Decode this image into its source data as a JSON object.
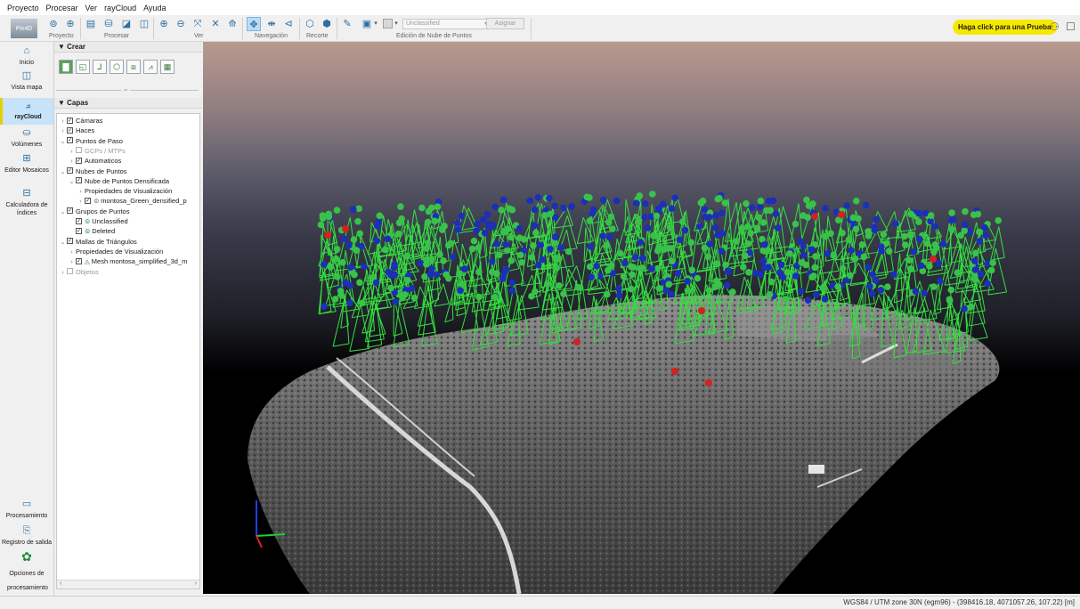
{
  "menu": [
    "Proyecto",
    "Procesar",
    "Ver",
    "rayCloud",
    "Ayuda"
  ],
  "toolbar": {
    "logo": "Pix4D",
    "groups": [
      "Proyecto",
      "Procesar",
      "Ver",
      "Navegación",
      "Recorte",
      "Edición de Nube de Puntos"
    ],
    "class_select": "Unclassified",
    "assign_label": "Asignar",
    "trial_label": "Haga click para una Prueba"
  },
  "rail": {
    "items": [
      "Inicio",
      "Vista mapa",
      "rayCloud",
      "Volúmenes",
      "Editor Mosaicos",
      "Calculadora de índices"
    ],
    "bottom": [
      "Procesamiento",
      "Registro de salida",
      "Opciones de procesamiento"
    ]
  },
  "panel": {
    "crear_title": "Crear",
    "capas_title": "Capas",
    "layers": [
      {
        "label": "Cámaras",
        "level": 0,
        "expander": "›",
        "check": true,
        "disabled": false
      },
      {
        "label": "Haces",
        "level": 0,
        "expander": "›",
        "check": true,
        "disabled": false
      },
      {
        "label": "Puntos de Paso",
        "level": 0,
        "expander": "⌄",
        "check": true,
        "disabled": false
      },
      {
        "label": "GCPs / MTPs",
        "level": 1,
        "expander": "›",
        "check": false,
        "disabled": true
      },
      {
        "label": "Automaticos",
        "level": 1,
        "expander": "›",
        "check": true,
        "disabled": false
      },
      {
        "label": "Nubes de Puntos",
        "level": 0,
        "expander": "⌄",
        "check": true,
        "disabled": false
      },
      {
        "label": "Nube de Puntos Densificada",
        "level": 1,
        "expander": "⌄",
        "check": true,
        "disabled": false
      },
      {
        "label": "Propiedades de Visualización",
        "level": 2,
        "expander": "›",
        "check": null,
        "disabled": false
      },
      {
        "label": "montosa_Green_densified_p",
        "level": 2,
        "expander": "›",
        "check": true,
        "disabled": false,
        "icon": "point-cloud-icon"
      },
      {
        "label": "Grupos de Puntos",
        "level": 0,
        "expander": "⌄",
        "check": true,
        "disabled": false
      },
      {
        "label": "Unclassified",
        "level": 1,
        "expander": "",
        "check": true,
        "disabled": false,
        "icon": "point-cloud-icon"
      },
      {
        "label": "Deleted",
        "level": 1,
        "expander": "",
        "check": true,
        "disabled": false,
        "icon": "point-cloud-icon"
      },
      {
        "label": "Mallas de Triángulos",
        "level": 0,
        "expander": "⌄",
        "check": true,
        "disabled": false
      },
      {
        "label": "Propiedades de Visualización",
        "level": 1,
        "expander": "›",
        "check": null,
        "disabled": false
      },
      {
        "label": "Mesh montosa_simplified_3d_m",
        "level": 1,
        "expander": "›",
        "check": true,
        "disabled": false,
        "icon": "mesh-icon"
      },
      {
        "label": "Objetos",
        "level": 0,
        "expander": "›",
        "check": false,
        "disabled": true
      }
    ]
  },
  "status": {
    "coords": "WGS84 / UTM zone 30N (egm96) - (398416.18, 4071057.26, 107.22) [m]"
  },
  "colors": {
    "camera_frustum": "#35e040",
    "camera_blue": "#1c2fb8",
    "camera_green": "#39c24a",
    "gcp_red": "#d42020",
    "trial": "#f7e800"
  }
}
